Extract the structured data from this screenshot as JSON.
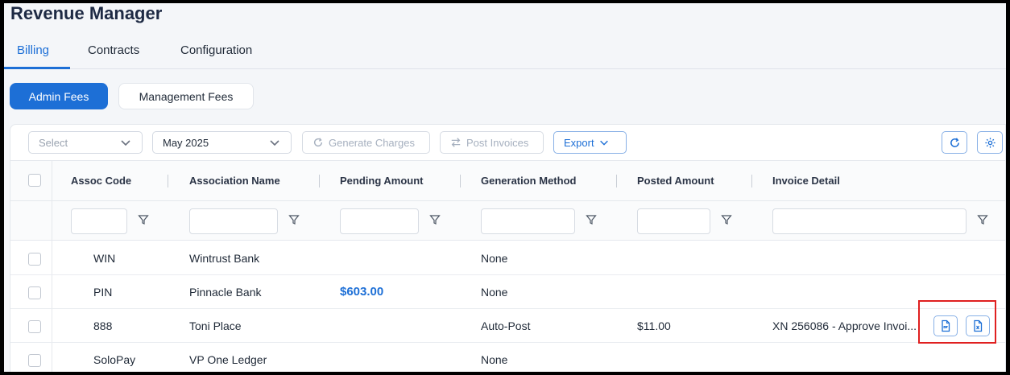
{
  "app": {
    "title": "Revenue Manager"
  },
  "tabs": [
    {
      "label": "Billing",
      "active": true
    },
    {
      "label": "Contracts",
      "active": false
    },
    {
      "label": "Configuration",
      "active": false
    }
  ],
  "fee_tabs": {
    "admin": "Admin Fees",
    "management": "Management Fees"
  },
  "toolbar": {
    "select_placeholder": "Select",
    "period": "May 2025",
    "generate": "Generate Charges",
    "post": "Post Invoices",
    "export": "Export"
  },
  "columns": [
    "Assoc Code",
    "Association Name",
    "Pending Amount",
    "Generation Method",
    "Posted Amount",
    "Invoice Detail"
  ],
  "rows": [
    {
      "code": "WIN",
      "name": "Wintrust Bank",
      "pending": "",
      "method": "None",
      "posted": "",
      "detail": ""
    },
    {
      "code": "PIN",
      "name": "Pinnacle Bank",
      "pending": "$603.00",
      "method": "None",
      "posted": "",
      "detail": ""
    },
    {
      "code": "888",
      "name": "Toni Place",
      "pending": "",
      "method": "Auto-Post",
      "posted": "$11.00",
      "detail": "XN 256086 - Approve Invoi..."
    },
    {
      "code": "SoloPay",
      "name": "VP One Ledger",
      "pending": "",
      "method": "None",
      "posted": "",
      "detail": ""
    }
  ],
  "colors": {
    "accent": "#1d6fd6",
    "highlight": "#e02020"
  },
  "icons": {
    "refresh": "refresh-icon",
    "settings": "gear-icon",
    "filter": "filter-icon",
    "pdf": "pdf-file-icon",
    "excel": "excel-file-icon"
  }
}
